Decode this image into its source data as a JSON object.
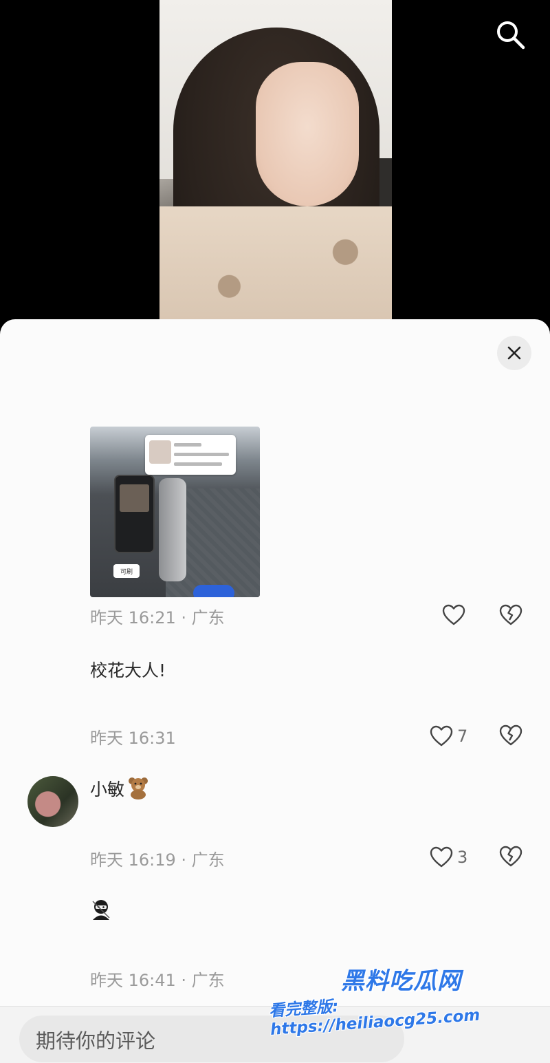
{
  "header": {
    "search_icon": "search-icon"
  },
  "panel": {
    "close_icon": "close-icon"
  },
  "comments": [
    {
      "has_image": true,
      "image_texts": {
        "tag": "可刷"
      },
      "meta": "昨天 16:21 · 广东",
      "likes": "",
      "next_text": "校花大人!"
    },
    {
      "meta": "昨天 16:31",
      "likes": "7",
      "author": "小敏",
      "text_emoji": "teddy-bear-icon"
    },
    {
      "meta": "昨天 16:19 · 广东",
      "likes": "3",
      "text_emoji": "ninja-icon"
    },
    {
      "meta": "昨天 16:41 · 广东"
    }
  ],
  "input": {
    "placeholder": "期待你的评论"
  },
  "watermark": {
    "logo": "黑料吃瓜网",
    "url": "看完整版: https://heiliaocg25.com"
  },
  "colors": {
    "sheet_bg": "#fbfbfb",
    "meta_text": "#9a9a9a",
    "watermark_blue": "#2e78e8"
  }
}
